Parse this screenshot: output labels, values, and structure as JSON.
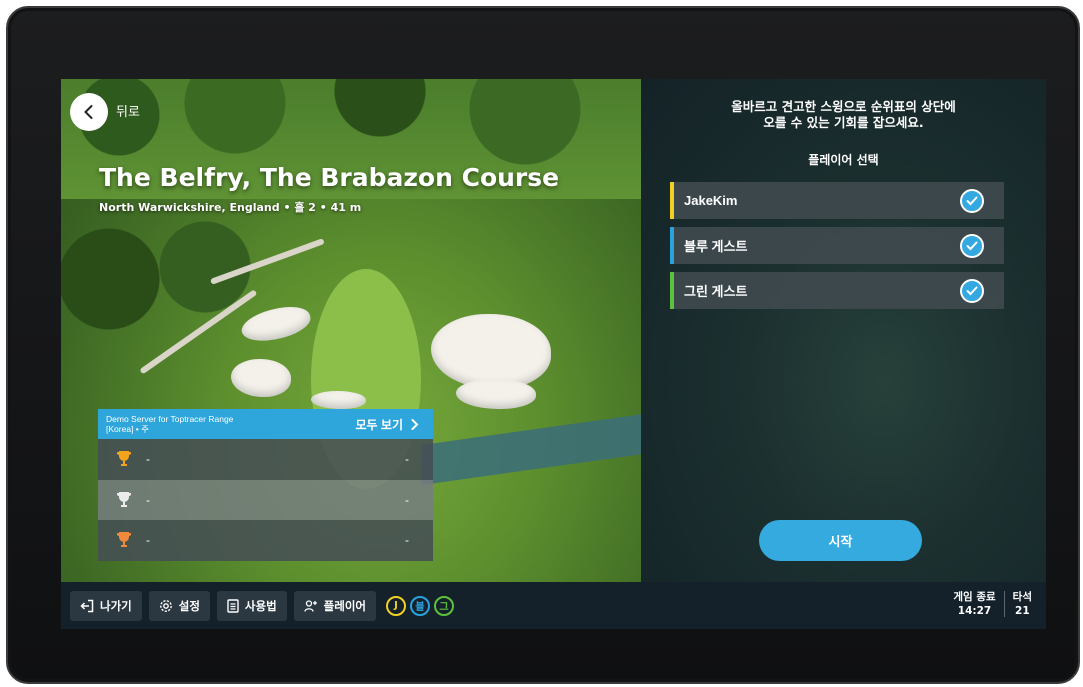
{
  "header": {
    "back_label": "뒤로",
    "course_title": "The Belfry, The Brabazon Course",
    "course_subtitle": "North Warwickshire, England • 홀 2 • 41 m"
  },
  "leaderboard": {
    "server": "Demo Server for Toptracer Range",
    "server_line2": "[Korea] • 주",
    "view_all": "모두 보기",
    "rows": [
      {
        "trophy": "gold-trophy-icon",
        "color": "#f2a51c",
        "name": "-",
        "score": "-"
      },
      {
        "trophy": "silver-trophy-icon",
        "color": "#e8e8e8",
        "name": "-",
        "score": "-"
      },
      {
        "trophy": "bronze-trophy-icon",
        "color": "#f08a3c",
        "name": "-",
        "score": "-"
      }
    ]
  },
  "panel": {
    "tagline_line1": "올바르고 견고한 스윙으로 순위표의 상단에",
    "tagline_line2": "오를 수 있는 기회를 잡으세요.",
    "select_title": "플레이어 선택",
    "players": [
      {
        "name": "JakeKim",
        "color": "#f1d024",
        "checked": true
      },
      {
        "name": "블루 게스트",
        "color": "#2aa3dc",
        "checked": true
      },
      {
        "name": "그린 게스트",
        "color": "#5cc23c",
        "checked": true
      }
    ],
    "start_label": "시작"
  },
  "bottom_bar": {
    "exit_label": "나가기",
    "settings_label": "설정",
    "howto_label": "사용법",
    "players_label": "플레이어",
    "player_chips": [
      {
        "letter": "J",
        "color": "#f1d024"
      },
      {
        "letter": "블",
        "color": "#2aa3dc"
      },
      {
        "letter": "그",
        "color": "#5cc23c"
      }
    ],
    "game_end_label": "게임 종료",
    "game_end_time": "14:27",
    "bay_label": "타석",
    "bay_number": "21"
  }
}
